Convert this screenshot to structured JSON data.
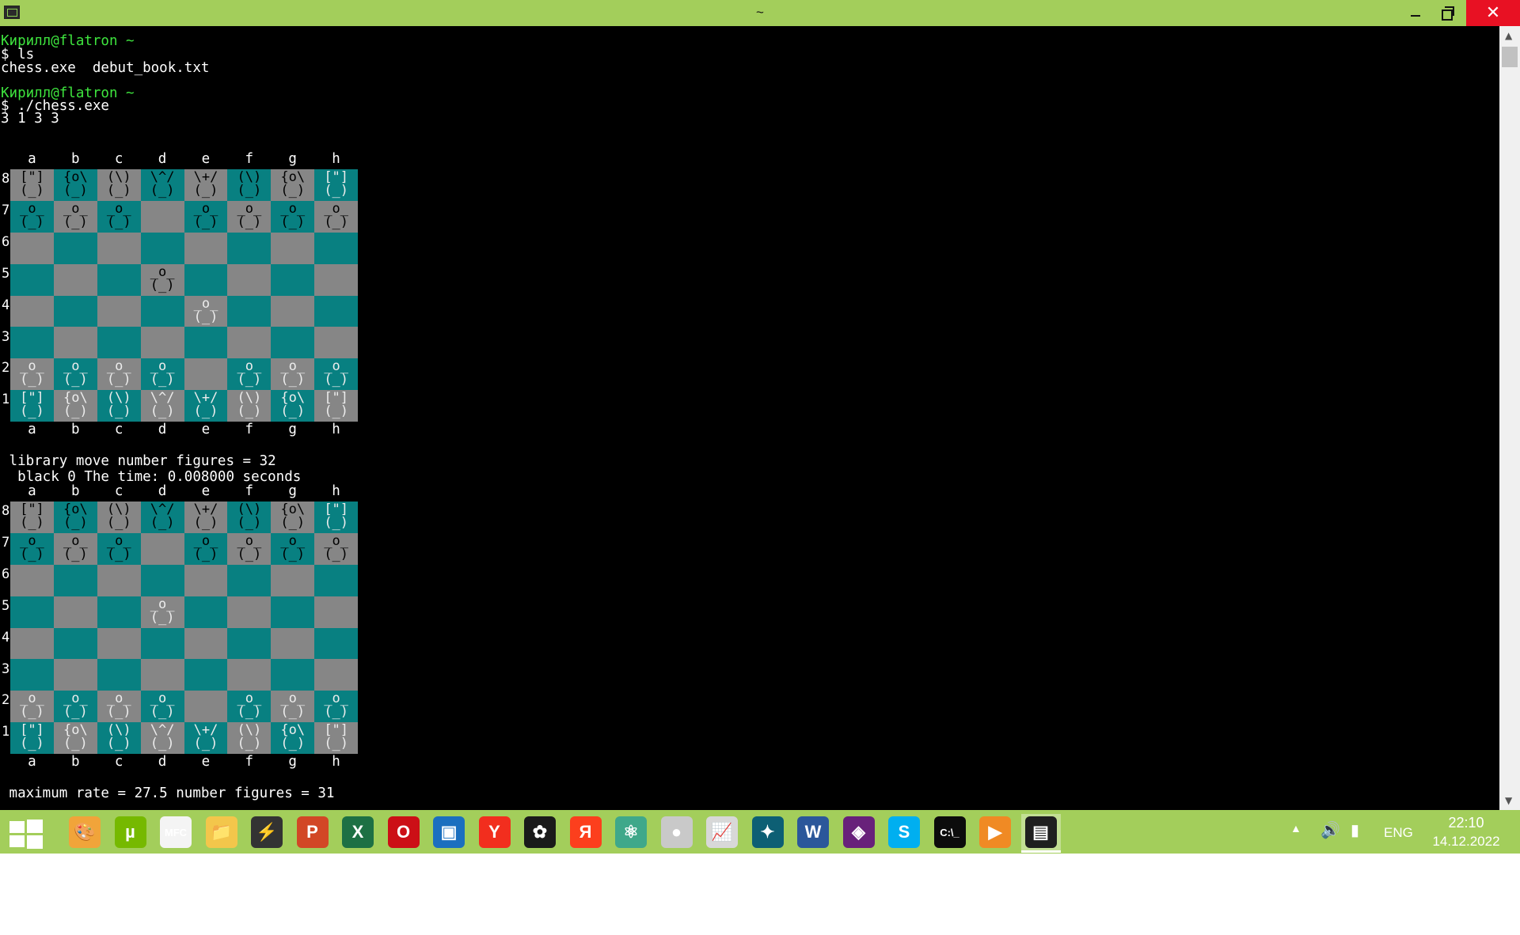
{
  "window": {
    "title": "~",
    "buttons": {
      "minimize": "minimize",
      "maximize": "maximize",
      "close": "✕"
    }
  },
  "terminal": {
    "prompt1": "Кирилл@flatron ~",
    "cmd1": "$ ls",
    "ls_output": "chess.exe  debut_book.txt",
    "prompt2": "Кирилл@flatron ~",
    "cmd2": "$ ./chess.exe",
    "move_input": "3 1 3 3",
    "info_line1": " library move number figures = 32",
    "info_line2": "  black 0 The time: 0.008000 seconds",
    "info_line3": " maximum rate = 27.5 number figures = 31"
  },
  "board_labels": {
    "files": [
      "a",
      "b",
      "c",
      "d",
      "e",
      "f",
      "g",
      "h"
    ],
    "ranks": [
      "8",
      "7",
      "6",
      "5",
      "4",
      "3",
      "2",
      "1"
    ]
  },
  "pieces": {
    "rook": "[\"]\n(_)",
    "knight": "{o\\\n(_)",
    "bishop": "(\\)\n(_)",
    "queen": "\\^/\n(_)",
    "king": "\\+/\n(_)",
    "pawn": "_o_\n(_)"
  },
  "board1": {
    "rows": [
      [
        "rook:b",
        "knight:b",
        "bishop:b",
        "queen:b",
        "king:b",
        "bishop:b",
        "knight:b",
        "rook:w"
      ],
      [
        "pawn:b",
        "pawn:b",
        "pawn:b",
        "",
        "pawn:b",
        "pawn:b",
        "pawn:b",
        "pawn:b"
      ],
      [
        "",
        "",
        "",
        "",
        "",
        "",
        "",
        ""
      ],
      [
        "",
        "",
        "",
        "pawn:b",
        "",
        "",
        "",
        ""
      ],
      [
        "",
        "",
        "",
        "",
        "pawn:w",
        "",
        "",
        ""
      ],
      [
        "",
        "",
        "",
        "",
        "",
        "",
        "",
        ""
      ],
      [
        "pawn:w",
        "pawn:w",
        "pawn:w",
        "pawn:w",
        "",
        "pawn:w",
        "pawn:w",
        "pawn:w"
      ],
      [
        "rook:w",
        "knight:w",
        "bishop:w",
        "queen:w",
        "king:w",
        "bishop:w",
        "knight:w",
        "rook:w"
      ]
    ]
  },
  "board2": {
    "rows": [
      [
        "rook:b",
        "knight:b",
        "bishop:b",
        "queen:b",
        "king:b",
        "bishop:b",
        "knight:b",
        "rook:w"
      ],
      [
        "pawn:b",
        "pawn:b",
        "pawn:b",
        "",
        "pawn:b",
        "pawn:b",
        "pawn:b",
        "pawn:b"
      ],
      [
        "",
        "",
        "",
        "",
        "",
        "",
        "",
        ""
      ],
      [
        "",
        "",
        "",
        "pawn:w",
        "",
        "",
        "",
        ""
      ],
      [
        "",
        "",
        "",
        "",
        "",
        "",
        "",
        ""
      ],
      [
        "",
        "",
        "",
        "",
        "",
        "",
        "",
        ""
      ],
      [
        "pawn:w",
        "pawn:w",
        "pawn:w",
        "pawn:w",
        "",
        "pawn:w",
        "pawn:w",
        "pawn:w"
      ],
      [
        "rook:w",
        "knight:w",
        "bishop:w",
        "queen:w",
        "king:w",
        "bishop:w",
        "knight:w",
        "rook:w"
      ]
    ]
  },
  "colors": {
    "titlebar": "#a3ce5b",
    "light_square": "#868686",
    "dark_square": "#088081",
    "prompt_green": "#3ee43e",
    "close_red": "#e81123"
  },
  "taskbar": {
    "apps": [
      {
        "name": "paint-icon",
        "glyph": "🎨",
        "bg": "#f1a43a"
      },
      {
        "name": "utorrent-icon",
        "glyph": "µ",
        "bg": "#76b900"
      },
      {
        "name": "mfc-icon",
        "glyph": "MFC",
        "bg": "#f4f4f4"
      },
      {
        "name": "file-explorer-icon",
        "glyph": "📁",
        "bg": "#f3c64b"
      },
      {
        "name": "winamp-icon",
        "glyph": "⚡",
        "bg": "#333333"
      },
      {
        "name": "powerpoint-icon",
        "glyph": "P",
        "bg": "#d24726"
      },
      {
        "name": "excel-icon",
        "glyph": "X",
        "bg": "#1d7044"
      },
      {
        "name": "opera-icon",
        "glyph": "O",
        "bg": "#cc0f16"
      },
      {
        "name": "virtualbox-icon",
        "glyph": "▣",
        "bg": "#1b6fbf"
      },
      {
        "name": "yandex-browser-icon",
        "glyph": "Y",
        "bg": "#f22e1e"
      },
      {
        "name": "icq-icon",
        "glyph": "✿",
        "bg": "#1a1a1a"
      },
      {
        "name": "yandex-icon",
        "glyph": "Я",
        "bg": "#fc3f1d"
      },
      {
        "name": "atom-icon",
        "glyph": "⚛",
        "bg": "#3fa88a"
      },
      {
        "name": "recorder-icon",
        "glyph": "●",
        "bg": "#c9c9c9"
      },
      {
        "name": "system-monitor-icon",
        "glyph": "📈",
        "bg": "#d8d8d8"
      },
      {
        "name": "maple-icon",
        "glyph": "✦",
        "bg": "#0d5f74"
      },
      {
        "name": "word-icon",
        "glyph": "W",
        "bg": "#2b579a"
      },
      {
        "name": "visual-studio-icon",
        "glyph": "◈",
        "bg": "#68217a"
      },
      {
        "name": "skype-icon",
        "glyph": "S",
        "bg": "#00aff0"
      },
      {
        "name": "cmd-icon",
        "glyph": "C:\\_",
        "bg": "#0c0c0c"
      },
      {
        "name": "media-player-icon",
        "glyph": "▶",
        "bg": "#f08a24"
      },
      {
        "name": "mintty-icon",
        "glyph": "▤",
        "bg": "#1f1f1f"
      }
    ],
    "tray": {
      "show_hidden": "▲",
      "volume": "🔊",
      "power": "▮",
      "language": "ENG",
      "time": "22:10",
      "date": "14.12.2022"
    }
  }
}
